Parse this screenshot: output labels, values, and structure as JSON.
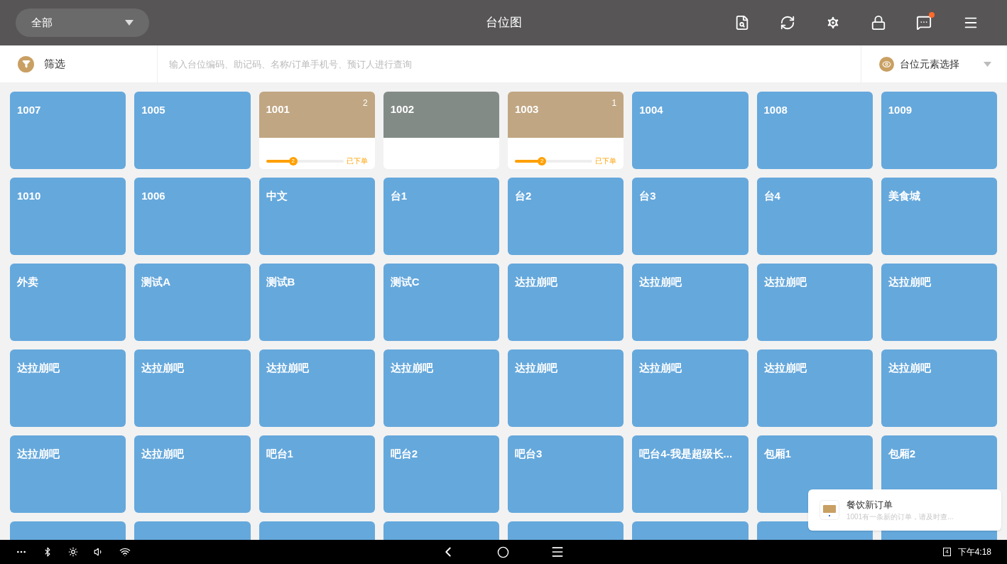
{
  "header": {
    "area_select": "全部",
    "title": "台位图"
  },
  "filter_bar": {
    "filter_label": "筛选",
    "search": {
      "placeholder": "输入台位编码、助记码、名称/订单手机号、预订人进行查询"
    },
    "element_select": "台位元素选择"
  },
  "tables": [
    {
      "name": "1007",
      "kind": "free"
    },
    {
      "name": "1005",
      "kind": "free"
    },
    {
      "name": "1001",
      "kind": "ordered",
      "count": "2",
      "level": 0.35,
      "step": "2",
      "status": "已下单"
    },
    {
      "name": "1002",
      "kind": "occupied"
    },
    {
      "name": "1003",
      "kind": "ordered",
      "count": "1",
      "level": 0.35,
      "step": "2",
      "status": "已下单"
    },
    {
      "name": "1004",
      "kind": "free"
    },
    {
      "name": "1008",
      "kind": "free"
    },
    {
      "name": "1009",
      "kind": "free"
    },
    {
      "name": "1010",
      "kind": "free"
    },
    {
      "name": "1006",
      "kind": "free"
    },
    {
      "name": "中文",
      "kind": "free"
    },
    {
      "name": "台1",
      "kind": "free"
    },
    {
      "name": "台2",
      "kind": "free"
    },
    {
      "name": "台3",
      "kind": "free"
    },
    {
      "name": "台4",
      "kind": "free"
    },
    {
      "name": "美食城",
      "kind": "free"
    },
    {
      "name": "外卖",
      "kind": "free"
    },
    {
      "name": "测试A",
      "kind": "free"
    },
    {
      "name": "测试B",
      "kind": "free"
    },
    {
      "name": "测试C",
      "kind": "free"
    },
    {
      "name": "达拉崩吧",
      "kind": "free"
    },
    {
      "name": "达拉崩吧",
      "kind": "free"
    },
    {
      "name": "达拉崩吧",
      "kind": "free"
    },
    {
      "name": "达拉崩吧",
      "kind": "free"
    },
    {
      "name": "达拉崩吧",
      "kind": "free"
    },
    {
      "name": "达拉崩吧",
      "kind": "free"
    },
    {
      "name": "达拉崩吧",
      "kind": "free"
    },
    {
      "name": "达拉崩吧",
      "kind": "free"
    },
    {
      "name": "达拉崩吧",
      "kind": "free"
    },
    {
      "name": "达拉崩吧",
      "kind": "free"
    },
    {
      "name": "达拉崩吧",
      "kind": "free"
    },
    {
      "name": "达拉崩吧",
      "kind": "free"
    },
    {
      "name": "达拉崩吧",
      "kind": "free"
    },
    {
      "name": "达拉崩吧",
      "kind": "free"
    },
    {
      "name": "吧台1",
      "kind": "free"
    },
    {
      "name": "吧台2",
      "kind": "free"
    },
    {
      "name": "吧台3",
      "kind": "free"
    },
    {
      "name": "吧台4-我是超级长...",
      "kind": "free"
    },
    {
      "name": "包厢1",
      "kind": "free"
    },
    {
      "name": "包厢2",
      "kind": "free"
    },
    {
      "kind": "free"
    },
    {
      "kind": "free"
    },
    {
      "kind": "free"
    },
    {
      "kind": "free"
    },
    {
      "kind": "free"
    },
    {
      "kind": "free"
    },
    {
      "kind": "free"
    },
    {
      "kind": "free"
    }
  ],
  "notification": {
    "title": "餐饮新订单",
    "message": "1001有一条新的订单，请及时查..."
  },
  "status_bar": {
    "badge": "4",
    "time": "下午4:18"
  }
}
